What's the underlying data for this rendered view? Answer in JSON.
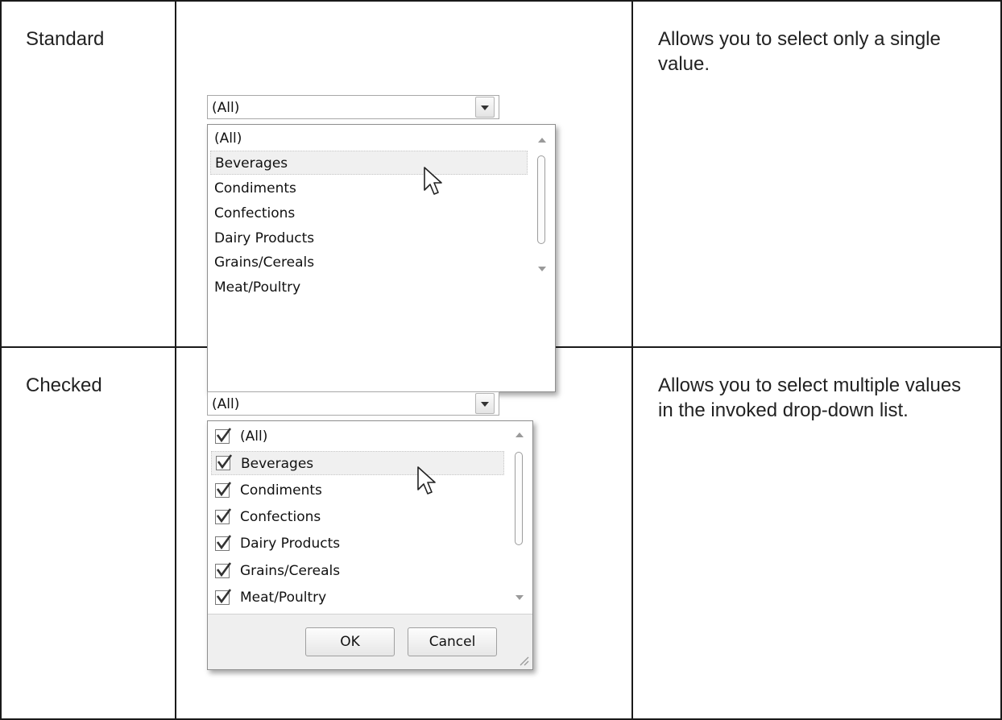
{
  "rows": [
    {
      "name": "Standard",
      "description": "Allows you to select only a single value.",
      "combo": {
        "value": "(All)",
        "items": [
          "(All)",
          "Beverages",
          "Condiments",
          "Confections",
          "Dairy Products",
          "Grains/Cereals",
          "Meat/Poultry"
        ],
        "highlighted_item": "Beverages"
      }
    },
    {
      "name": "Checked",
      "description": "Allows you to select multiple values in the invoked drop-down list.",
      "combo": {
        "value": "(All)",
        "items": [
          "(All)",
          "Beverages",
          "Condiments",
          "Confections",
          "Dairy Products",
          "Grains/Cereals",
          "Meat/Poultry"
        ],
        "highlighted_item": "Beverages",
        "ok_label": "OK",
        "cancel_label": "Cancel"
      }
    }
  ],
  "icons": {
    "dropdown": "chevron-down-icon",
    "checkbox": "checkmark-icon",
    "cursor": "mouse-pointer-icon",
    "resize": "resize-grip-icon"
  }
}
